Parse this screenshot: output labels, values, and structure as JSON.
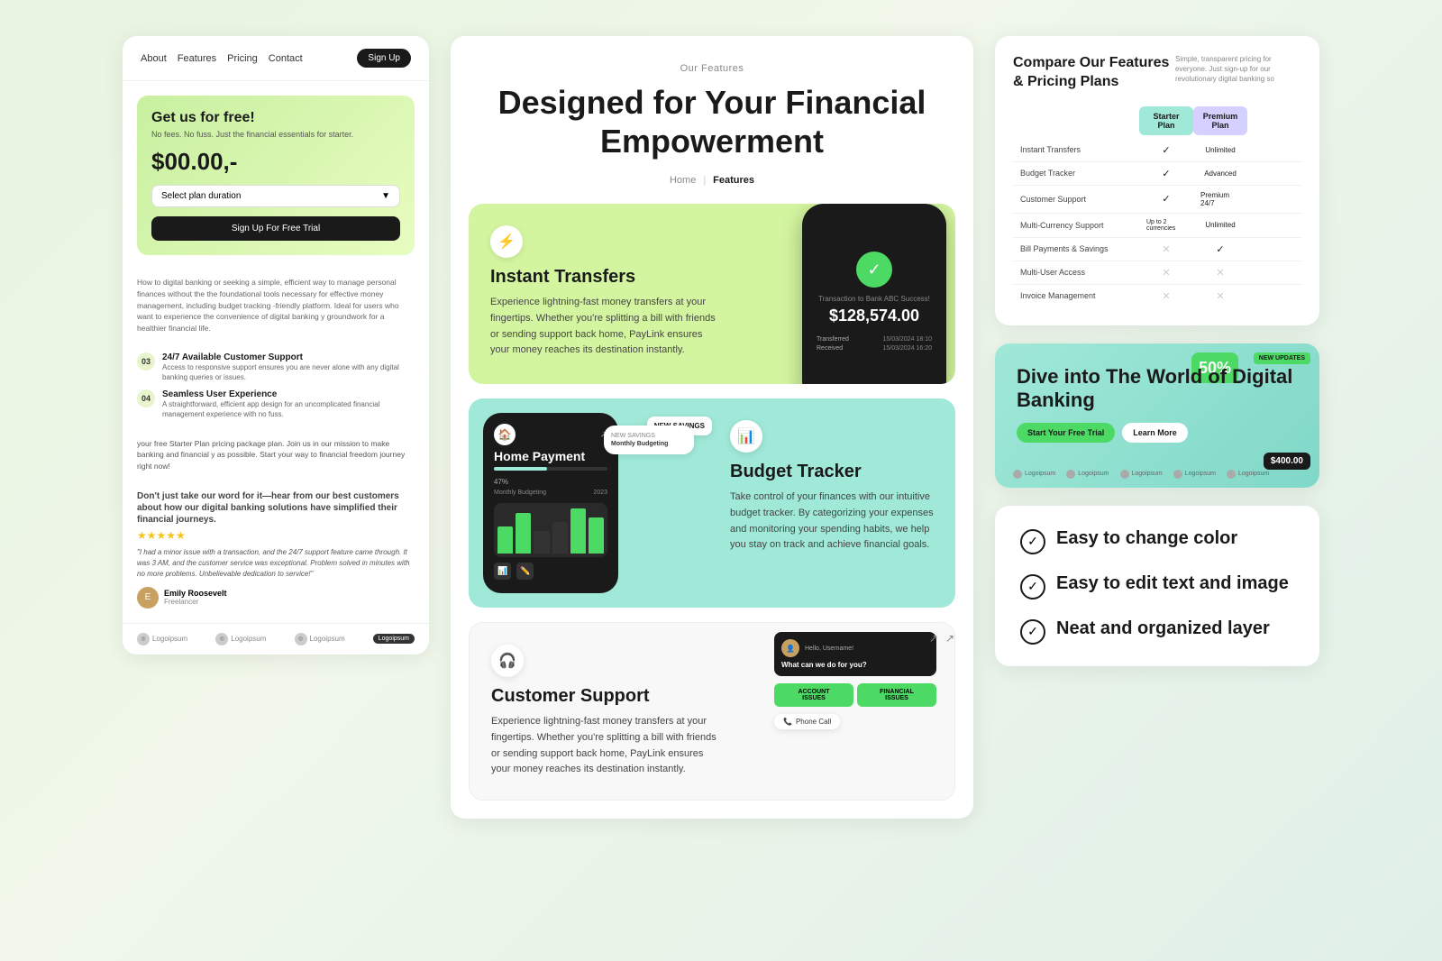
{
  "left": {
    "nav": {
      "links": [
        "About",
        "Features",
        "Pricing",
        "Contact"
      ],
      "signup_label": "Sign Up"
    },
    "promo": {
      "title": "Get us for free!",
      "subtitle": "No fees. No fuss. Just the financial essentials for starter.",
      "price": "$00.00,-",
      "plan_placeholder": "Select plan duration",
      "trial_btn": "Sign Up For Free Trial"
    },
    "body_text": "How to digital banking or seeking a simple, efficient way to manage personal finances without the\nthe foundational tools necessary for effective money management, including budget tracking\n-friendly platform. Ideal for users who want to experience the convenience of digital banking\ny groundwork for a healthier financial life.",
    "features": [
      {
        "num": "03",
        "name": "24/7 Available Customer Support",
        "desc": "Access to responsive support ensures you are never alone with any digital banking queries or issues."
      },
      {
        "num": "04",
        "name": "Seamless User Experience",
        "desc": "A straightforward, efficient app design for an uncomplicated financial management experience with no fuss."
      }
    ],
    "cta_text": "your free Starter Plan pricing package plan. Join us in our mission to make banking and financial y as possible. Start your way to financial freedom journey right now!",
    "testimonial": {
      "intro": "Don't just take our word for it—hear from our best customers about how our digital banking solutions have simplified their financial journeys.",
      "stars": "★★★★★",
      "quote": "\"I had a minor issue with a transaction, and the 24/7 support feature came through. It was 3 AM, and the customer service was exceptional. Problem solved in minutes with no more problems. Unbelievable dedication to service!\"",
      "reviewer_name": "Emily Roosevelt",
      "reviewer_role": "Freelancer",
      "reviewer_initial": "E"
    },
    "logos": [
      "Logoipsum",
      "Logoipsum",
      "Logoipsum",
      "Logoipsum"
    ]
  },
  "center": {
    "label": "Our Features",
    "title": "Designed for Your Financial Empowerment",
    "breadcrumb": [
      "Home",
      "|",
      "Features"
    ],
    "cards": [
      {
        "id": "instant-transfers",
        "icon": "⚡",
        "title": "Instant Transfers",
        "desc": "Experience lightning-fast money transfers at your fingertips. Whether you're splitting a bill with friends or sending support back home, PayLink ensures your money reaches its destination instantly.",
        "bg": "green",
        "phone": {
          "success_text": "Transaction to Bank ABC Success!",
          "amount": "$128,574.00",
          "rows": [
            {
              "label": "Transferred",
              "date": "15/03/2024 18:10"
            },
            {
              "label": "Received",
              "date": "15/03/2024 16:20"
            }
          ]
        }
      },
      {
        "id": "budget-tracker",
        "icon": "📊",
        "title": "Budget Tracker",
        "desc": "Take control of your finances with our intuitive budget tracker. By categorizing your expenses and monitoring your spending habits, we help you stay on track and achieve financial goals.",
        "bg": "teal",
        "phone": {
          "category": "Home Payment",
          "progress": 47,
          "chart_label": "Monthly Budgeting",
          "year": "2023"
        },
        "tag": "NEW SAVINGS"
      },
      {
        "id": "customer-support",
        "icon": "🎧",
        "title": "Customer Support",
        "desc": "Experience lightning-fast money transfers at your fingertips. Whether you're splitting a bill with friends or sending support back home, PayLink ensures your money reaches its destination instantly.",
        "bg": "white",
        "chat": {
          "greeting": "Hello, Username!",
          "question": "What can we do for you?",
          "options": [
            "ACCOUNT ISSUES",
            "FINANCIAL ISSUES"
          ],
          "phone_call": "Phone Call"
        }
      }
    ]
  },
  "right": {
    "pricing": {
      "title": "Compare Our Features & Pricing Plans",
      "subtitle": "Simple, transparent pricing for everyone. Just sign-up for our revolutionary digital banking so",
      "columns": [
        "",
        "Starter Plan",
        "Premium Plan",
        ""
      ],
      "rows": [
        {
          "feature": "Instant Transfers",
          "starter": "check",
          "premium": "Unlimited",
          "third": ""
        },
        {
          "feature": "Budget Tracker",
          "starter": "check",
          "premium": "Advanced",
          "third": ""
        },
        {
          "feature": "Customer Support",
          "starter": "check",
          "premium": "Premium 24/7",
          "third": ""
        },
        {
          "feature": "Multi-Currency Support",
          "starter": "Up to 2 currencies",
          "premium": "Unlimited",
          "third": ""
        },
        {
          "feature": "Bill Payments & Savings",
          "starter": "cross",
          "premium": "check",
          "third": ""
        },
        {
          "feature": "Multi-User Access",
          "starter": "cross",
          "premium": "cross",
          "third": ""
        },
        {
          "feature": "Invoice Management",
          "starter": "cross",
          "premium": "cross",
          "third": ""
        }
      ]
    },
    "banner": {
      "title": "Dive into The World of Digital Banking",
      "btn_primary": "Start Your Free Trial",
      "btn_secondary": "Learn More",
      "badge": "NEW UPDATES",
      "fifty": "50%",
      "amount": "$400.00",
      "logos": [
        "Logoipsum",
        "Logoipsum",
        "Logoipsum",
        "Logoipsum",
        "Logoipsum"
      ]
    },
    "summary": {
      "items": [
        "Easy to change color",
        "Easy to edit text and image",
        "Neat and organized layer"
      ]
    }
  }
}
